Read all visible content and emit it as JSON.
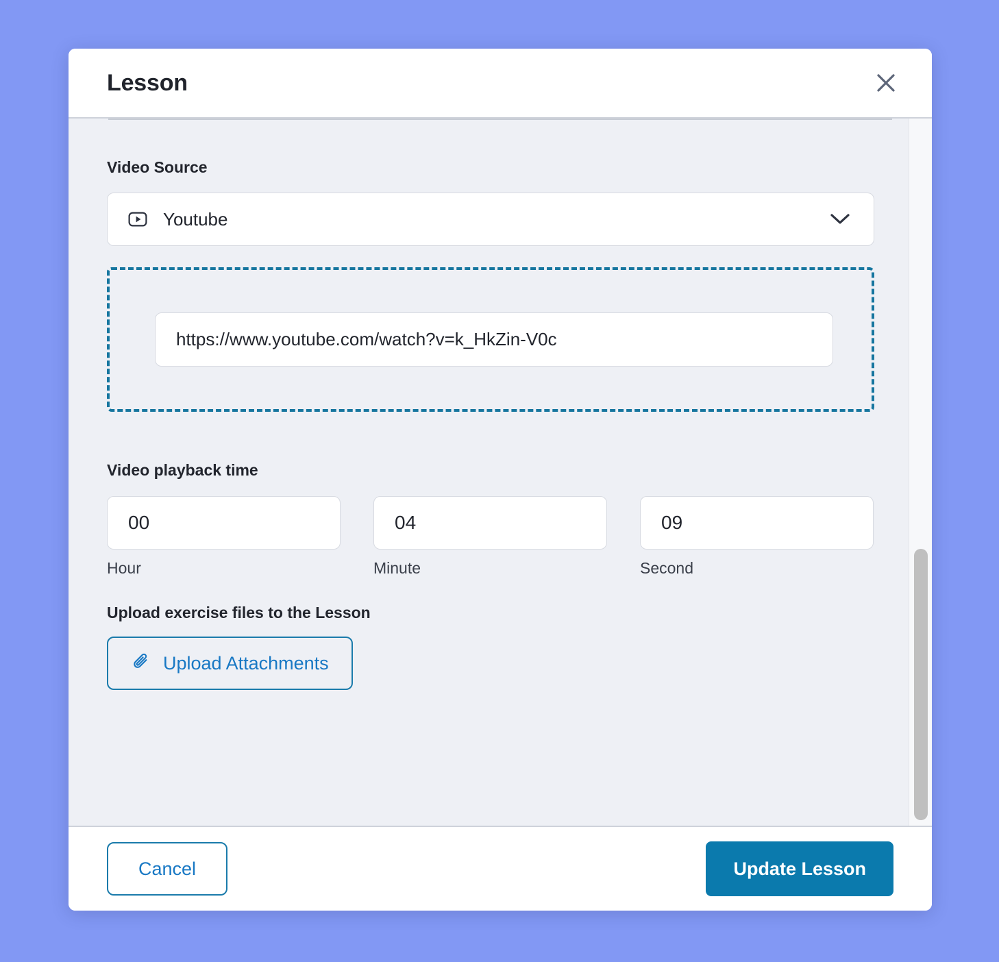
{
  "theme": {
    "backdrop": "#8298f4",
    "accent_blue": "#0b7aad",
    "link_blue": "#1878c4",
    "dashed_border": "#16769f",
    "body_bg": "#eef0f5",
    "text_dark": "#21242c"
  },
  "header": {
    "title": "Lesson",
    "close_icon": "close-icon"
  },
  "body": {
    "video_source": {
      "label": "Video Source",
      "selected": "Youtube",
      "icon": "youtube-icon",
      "chevron": "chevron-down-icon"
    },
    "video_url": {
      "value": "https://www.youtube.com/watch?v=k_HkZin-V0c",
      "placeholder": "https://www.youtube.com/watch?v=k_HkZin-V0c"
    },
    "playback": {
      "label": "Video playback time",
      "fields": [
        {
          "value": "00",
          "sublabel": "Hour"
        },
        {
          "value": "04",
          "sublabel": "Minute"
        },
        {
          "value": "09",
          "sublabel": "Second"
        }
      ]
    },
    "upload": {
      "label": "Upload exercise files to the Lesson",
      "button_label": "Upload Attachments",
      "icon": "paperclip-icon"
    }
  },
  "footer": {
    "cancel_label": "Cancel",
    "update_label": "Update Lesson"
  }
}
